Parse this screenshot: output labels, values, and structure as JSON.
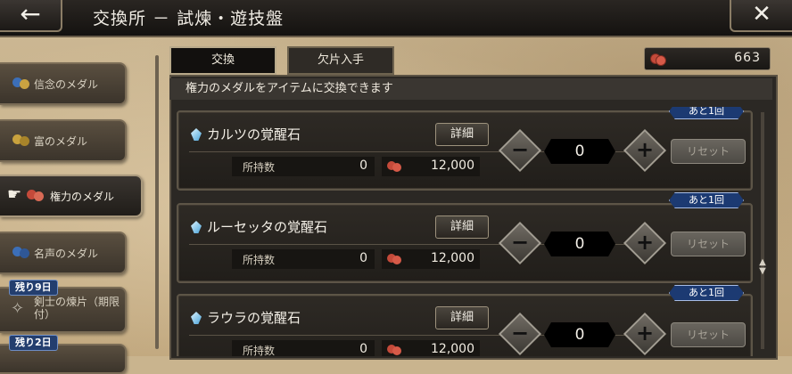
{
  "header": {
    "back_icon": "arrow-left-icon",
    "title": "交換所 － 試煉・遊技盤",
    "close_icon": "close-icon"
  },
  "tabs": [
    {
      "label": "交換",
      "active": true
    },
    {
      "label": "欠片入手",
      "active": false
    }
  ],
  "currency": {
    "icon": "coin-stack-icon",
    "value": "663"
  },
  "banner": {
    "text": "権力のメダルをアイテムに交換できます"
  },
  "sidebar": {
    "items": [
      {
        "label": "信念のメダル",
        "active": false
      },
      {
        "label": "富のメダル",
        "active": false
      },
      {
        "label": "権力のメダル",
        "active": true
      },
      {
        "label": "名声のメダル",
        "active": false
      },
      {
        "label": "剣士の煉片（期限付）",
        "active": false,
        "badge": "残り9日"
      },
      {
        "label": "",
        "active": false,
        "badge": "残り2日"
      }
    ]
  },
  "items": [
    {
      "name": "カルツの覚醒石",
      "detail_label": "詳細",
      "owned_label": "所持数",
      "owned": "0",
      "price": "12,000",
      "qty": "0",
      "reset_label": "リセット",
      "remaining": "あと1回"
    },
    {
      "name": "ルーセッタの覚醒石",
      "detail_label": "詳細",
      "owned_label": "所持数",
      "owned": "0",
      "price": "12,000",
      "qty": "0",
      "reset_label": "リセット",
      "remaining": "あと1回"
    },
    {
      "name": "ラウラの覚醒石",
      "detail_label": "詳細",
      "owned_label": "所持数",
      "owned": "0",
      "price": "12,000",
      "qty": "0",
      "reset_label": "リセット",
      "remaining": "あと1回"
    }
  ],
  "stepper": {
    "minus": "−",
    "plus": "+"
  }
}
